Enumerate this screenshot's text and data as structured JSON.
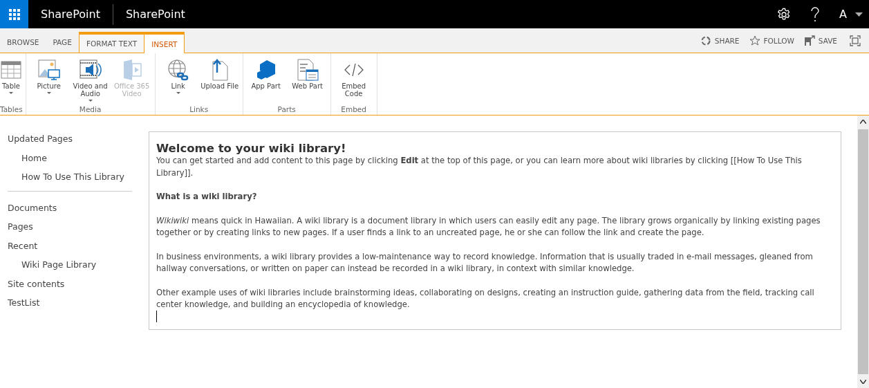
{
  "top_bar": {
    "brand": "SharePoint",
    "site": "SharePoint",
    "user": "A"
  },
  "ribbon_tabs": [
    {
      "label": "BROWSE",
      "selected": false,
      "contextual": false
    },
    {
      "label": "PAGE",
      "selected": false,
      "contextual": false
    },
    {
      "label": "FORMAT TEXT",
      "selected": false,
      "contextual": true
    },
    {
      "label": "INSERT",
      "selected": true,
      "contextual": true
    }
  ],
  "page_actions": [
    {
      "label": "SHARE"
    },
    {
      "label": "FOLLOW"
    },
    {
      "label": "SAVE"
    }
  ],
  "ribbon_groups": [
    {
      "label": "Tables",
      "buttons": [
        {
          "label": "Table",
          "dropdown": true,
          "disabled": false
        }
      ]
    },
    {
      "label": "Media",
      "buttons": [
        {
          "label": "Picture",
          "dropdown": true,
          "disabled": false
        },
        {
          "label": "Video and Audio",
          "dropdown": true,
          "disabled": false
        },
        {
          "label": "Office 365 Video",
          "dropdown": false,
          "disabled": true
        }
      ]
    },
    {
      "label": "Links",
      "buttons": [
        {
          "label": "Link",
          "dropdown": true,
          "disabled": false
        },
        {
          "label": "Upload File",
          "dropdown": false,
          "disabled": false
        }
      ]
    },
    {
      "label": "Parts",
      "buttons": [
        {
          "label": "App Part",
          "dropdown": false,
          "disabled": false
        },
        {
          "label": "Web Part",
          "dropdown": false,
          "disabled": false
        }
      ]
    },
    {
      "label": "Embed",
      "buttons": [
        {
          "label": "Embed Code",
          "dropdown": false,
          "disabled": false
        }
      ]
    }
  ],
  "sidebar": {
    "sections": [
      {
        "items": [
          {
            "label": "Updated Pages",
            "children": [
              {
                "label": "Home"
              },
              {
                "label": "How To Use This Library"
              }
            ]
          }
        ]
      },
      {
        "items": [
          {
            "label": "Documents"
          },
          {
            "label": "Pages"
          },
          {
            "label": "Recent",
            "children": [
              {
                "label": "Wiki Page Library"
              }
            ]
          },
          {
            "label": "Site contents"
          },
          {
            "label": "TestList"
          }
        ]
      }
    ]
  },
  "content": {
    "title": "Welcome to your wiki library!",
    "blocks": [
      {
        "kind": "text",
        "text": "You can get started and add content to this page by clicking **Edit** at the top of this page, or you can learn more about wiki libraries by clicking [[How To Use This Library]]."
      },
      {
        "kind": "heading",
        "text": "What is a wiki library?"
      },
      {
        "kind": "text",
        "text": "*Wikiwiki* means quick in Hawaiian. A wiki library is a document library in which users can easily edit any page. The library grows organically by linking existing pages together or by creating links to new pages. If a user finds a link to an uncreated page, he or she can follow the link and create the page."
      },
      {
        "kind": "text",
        "text": "In business environments, a wiki library provides a low-maintenance way to record knowledge. Information that is usually traded in e-mail messages, gleaned from hallway conversations, or written on paper can instead be recorded in a wiki library, in context with similar knowledge."
      },
      {
        "kind": "text",
        "text": "Other example uses of wiki libraries include brainstorming ideas, collaborating on designs, creating an instruction guide, gathering data from the field, tracking call center knowledge, and building an encyclopedia of knowledge."
      }
    ]
  }
}
